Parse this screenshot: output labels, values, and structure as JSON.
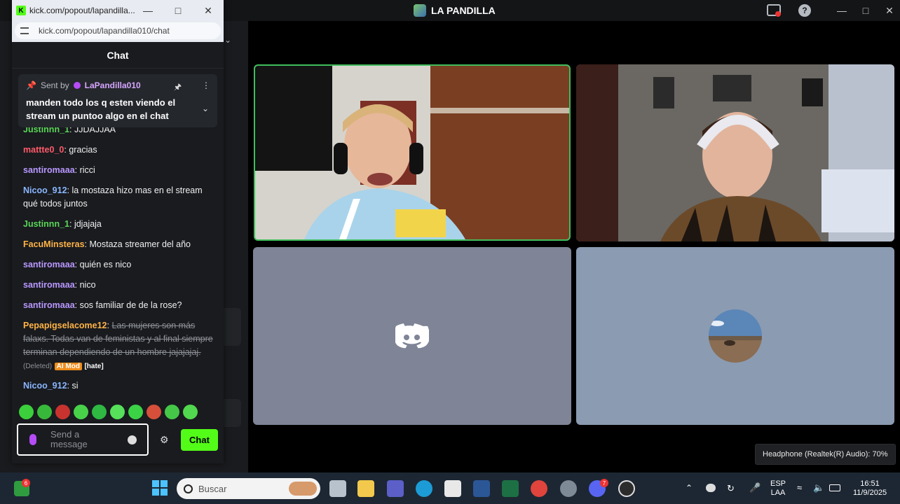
{
  "discord": {
    "server_title": "LA PANDILLA",
    "headphone_tooltip": "Headphone (Realtek(R) Audio): 70%"
  },
  "kick": {
    "window_title": "kick.com/popout/lapandilla...",
    "url": "kick.com/popout/lapandilla010/chat",
    "chat_header": "Chat",
    "pinned": {
      "sent_by_label": "Sent by",
      "user": "LaPandilla010",
      "text": "manden todo los q esten viendo el stream un puntoo algo en el chat"
    },
    "messages": [
      {
        "user": "Justinnn_1",
        "text": "JJDAJJAA",
        "color": "green"
      },
      {
        "user": "mattte0_0",
        "text": "gracias",
        "color": "red"
      },
      {
        "user": "santiromaaa",
        "text": "ricci",
        "color": "purple"
      },
      {
        "user": "Nicoo_912",
        "text": "la mostaza hizo mas en el stream qué todos juntos",
        "color": "blue"
      },
      {
        "user": "Justinnn_1",
        "text": "jdjajaja",
        "color": "green"
      },
      {
        "user": "FacuMinsteras",
        "text": "Mostaza streamer del año",
        "color": "orange"
      },
      {
        "user": "santiromaaa",
        "text": "quién es nico",
        "color": "purple"
      },
      {
        "user": "santiromaaa",
        "text": "nico",
        "color": "purple"
      },
      {
        "user": "santiromaaa",
        "text": "sos familiar de de la rose?",
        "color": "purple"
      },
      {
        "user": "Pepapigselacome12",
        "text": "Las mujeres son más falaxs. Todas van de feministas y al final siempre terminan dependiendo de un hombre jajajajaj.",
        "color": "orange",
        "deleted_tag": "(Deleted)",
        "ai_tag": "AI Mod",
        "hate_tag": "[hate]"
      },
      {
        "user": "Nicoo_912",
        "text": "si",
        "color": "blue"
      }
    ],
    "input_placeholder": "Send a message",
    "chat_button": "Chat"
  },
  "taskbar": {
    "search_label": "Buscar",
    "lang_top": "ESP",
    "lang_bottom": "LAA",
    "time": "16:51",
    "date": "11/9/2025",
    "badges": {
      "app_left": "6",
      "discord": "7"
    }
  },
  "colors": {
    "kick_green": "#53fc18",
    "speaking_border": "#3fbd5c",
    "discord_blurple": "#5865f2"
  }
}
